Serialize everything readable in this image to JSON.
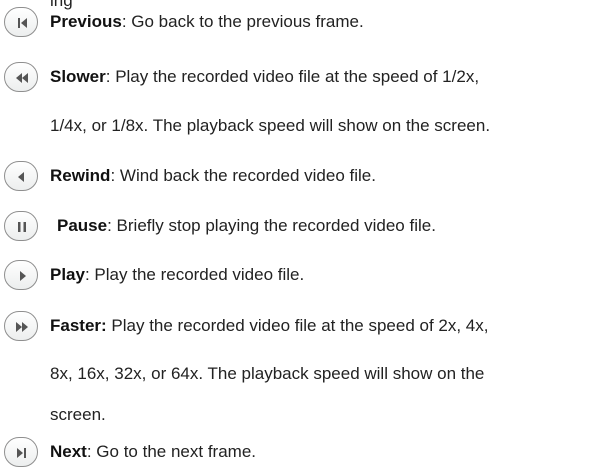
{
  "clipped_top_text": "ing",
  "controls": [
    {
      "icon": "step-back-icon",
      "term": "Previous",
      "desc": ": Go back to the previous frame."
    },
    {
      "icon": "slow-rewind-icon",
      "term": "Slower",
      "desc": ": Play the recorded video file at the speed of 1/2x,",
      "cont": [
        "1/4x, or 1/8x. The playback speed will show on the screen."
      ]
    },
    {
      "icon": "rewind-icon",
      "term": "Rewind",
      "desc": ": Wind back the recorded video file."
    },
    {
      "icon": "pause-icon",
      "term": "Pause",
      "desc": ": Briefly stop playing the recorded video file."
    },
    {
      "icon": "play-icon",
      "term": "Play",
      "desc": ": Play the recorded video file."
    },
    {
      "icon": "fast-forward-icon",
      "term": "Faster:",
      "desc": " Play the recorded video file at the speed of 2x, 4x,",
      "cont": [
        "8x, 16x, 32x, or 64x. The playback speed will show on the",
        "screen."
      ]
    },
    {
      "icon": "step-forward-icon",
      "term": "Next",
      "desc": ": Go to the next frame."
    }
  ]
}
